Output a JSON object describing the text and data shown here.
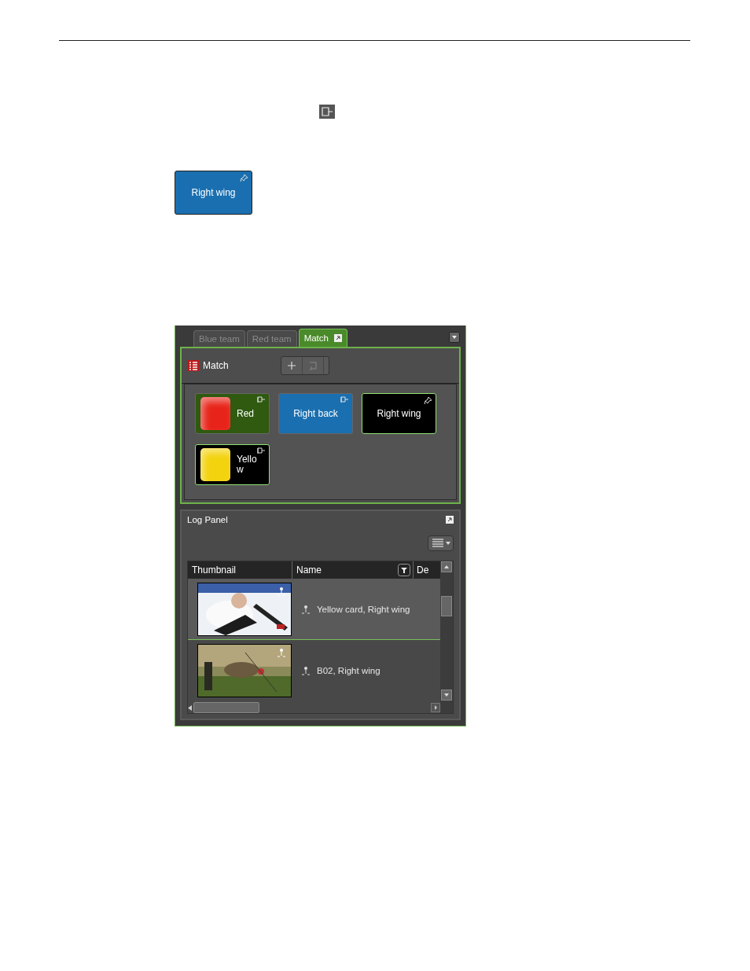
{
  "standalone_button": {
    "label": "Right wing",
    "color": "#1a6fb0",
    "pinned": true,
    "selected": false
  },
  "panel": {
    "tabs": [
      {
        "label": "Blue team",
        "selected": false
      },
      {
        "label": "Red team",
        "selected": false
      },
      {
        "label": "Match",
        "selected": true
      }
    ],
    "bin": {
      "title": "Match",
      "buttons": [
        {
          "kind": "swatch",
          "label": "Red",
          "color": "#2f5a10",
          "swatch": {
            "color": "#e8241a"
          },
          "pinned": false,
          "selected": false
        },
        {
          "kind": "plain",
          "label": "Right back",
          "color": "#1a6fb0",
          "pinned": false,
          "selected": false
        },
        {
          "kind": "plain",
          "label": "Right wing",
          "color": "#000000",
          "pinned": true,
          "selected": true
        },
        {
          "kind": "swatch",
          "label": "Yello\nw",
          "color": "#000000",
          "swatch": {
            "color": "#f3d20e"
          },
          "pinned": false,
          "selected": true
        }
      ]
    },
    "log_panel": {
      "title": "Log Panel",
      "columns": [
        "Thumbnail",
        "Name",
        "De"
      ],
      "rows": [
        {
          "name": "Yellow card, Right wing",
          "selected": true
        },
        {
          "name": "B02, Right wing",
          "selected": false
        }
      ]
    }
  }
}
